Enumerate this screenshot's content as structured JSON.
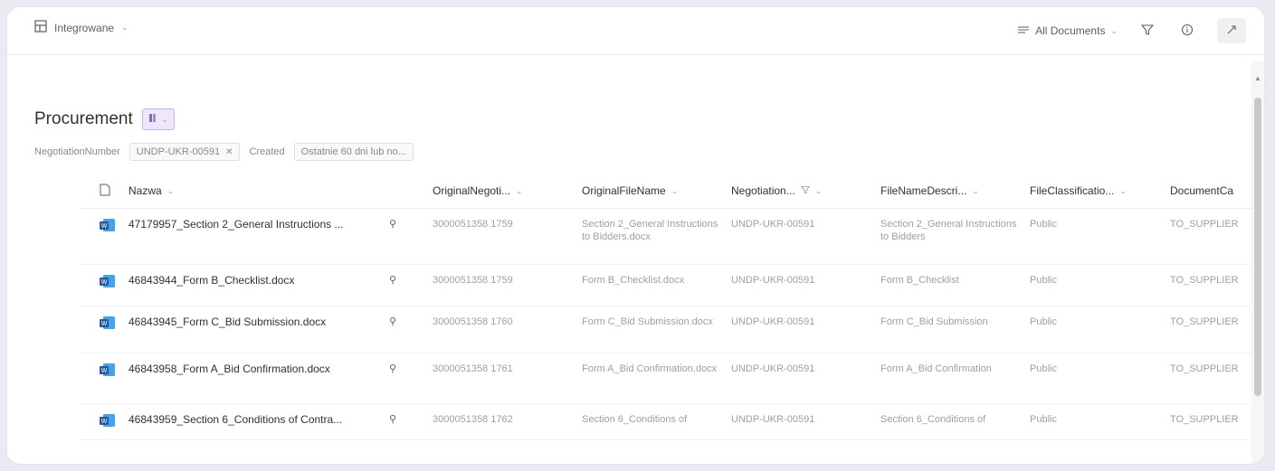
{
  "header": {
    "site_name": "Integrowane",
    "view_label": "All Documents"
  },
  "title": "Procurement",
  "filters": [
    {
      "label": "NegotiationNumber",
      "value": "UNDP-UKR-00591"
    },
    {
      "label": "Created",
      "value": "Ostatnie 60 dni lub no..."
    }
  ],
  "columns": [
    "Nazwa",
    "OriginalNegoti...",
    "OriginalFileName",
    "Negotiation...",
    "FileNameDescri...",
    "FileClassificatio...",
    "DocumentCa"
  ],
  "rows": [
    {
      "name": "47179957_Section 2_General Instructions ...",
      "orig_negot": "3000051358 1759",
      "orig_file": "Section 2_General Instructions to Bidders.docx",
      "negotiation": "UNDP-UKR-00591",
      "file_desc": "Section 2_General Instructions to Bidders",
      "classification": "Public",
      "doc_cat": "TO_SUPPLIER"
    },
    {
      "name": "46843944_Form B_Checklist.docx",
      "orig_negot": "3000051358 1759",
      "orig_file": "Form B_Checklist.docx",
      "negotiation": "UNDP-UKR-00591",
      "file_desc": "Form B_Checklist",
      "classification": "Public",
      "doc_cat": "TO_SUPPLIER"
    },
    {
      "name": "46843945_Form C_Bid Submission.docx",
      "orig_negot": "3000051358 1760",
      "orig_file": "Form C_Bid Submission.docx",
      "negotiation": "UNDP-UKR-00591",
      "file_desc": "Form C_Bid Submission",
      "classification": "Public",
      "doc_cat": "TO_SUPPLIER"
    },
    {
      "name": "46843958_Form A_Bid Confirmation.docx",
      "orig_negot": "3000051358 1761",
      "orig_file": "Form A_Bid Confirmation.docx",
      "negotiation": "UNDP-UKR-00591",
      "file_desc": "Form A_Bid Confirmation",
      "classification": "Public",
      "doc_cat": "TO_SUPPLIER"
    },
    {
      "name": "46843959_Section 6_Conditions of Contra...",
      "orig_negot": "3000051358 1762",
      "orig_file": "Section 6_Conditions of",
      "negotiation": "UNDP-UKR-00591",
      "file_desc": "Section 6_Conditions of",
      "classification": "Public",
      "doc_cat": "TO_SUPPLIER"
    }
  ],
  "colors": {
    "accent": "#2b579a",
    "badge_bg": "#efe7fb",
    "badge_border": "#c5b0e8"
  },
  "icons": [
    "site-icon",
    "view-list-icon",
    "filter-icon",
    "info-icon",
    "expand-icon",
    "file-header-icon",
    "word-doc-icon",
    "pin-icon"
  ]
}
